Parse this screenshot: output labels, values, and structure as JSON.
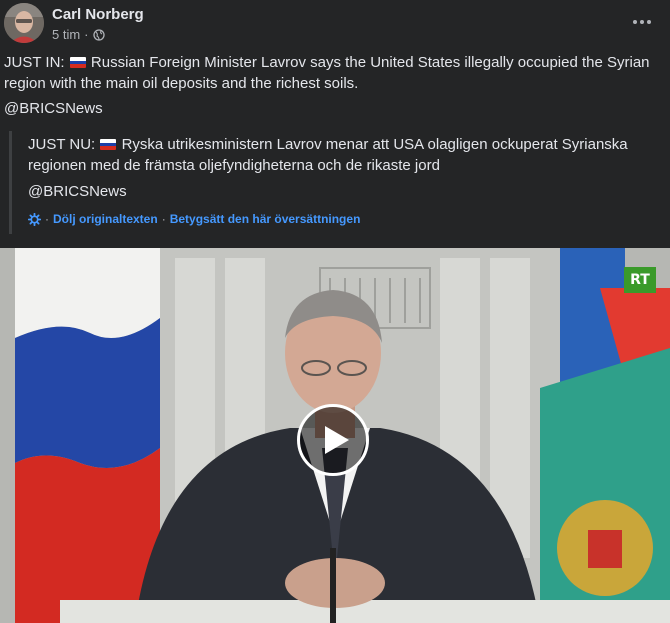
{
  "post": {
    "author": "Carl Norberg",
    "time": "5 tim",
    "separator": "·",
    "text_prefix": "JUST IN:",
    "text_body": "Russian Foreign Minister Lavrov says the United States illegally occupied the Syrian region with the main oil deposits and the richest soils.",
    "handle": "@BRICSNews"
  },
  "translation": {
    "text_prefix": "JUST NU:",
    "text_body": "Ryska utrikesministern Lavrov menar att USA olagligen ockuperat Syrianska regionen med de främsta oljefyndigheterna och de rikaste jord",
    "handle": "@BRICSNews",
    "dot": "·",
    "hide_original": "Dölj originaltexten",
    "rate_translation": "Betygsätt den här översättningen"
  },
  "video": {
    "channel_logo": "RT"
  },
  "icons": {
    "globe": "globe-icon",
    "more": "more-options-icon",
    "settings": "gear-icon",
    "play": "play-icon",
    "flag": "russia-flag-icon"
  },
  "colors": {
    "background": "#242526",
    "text": "#e4e6eb",
    "secondary": "#b0b3b8",
    "link": "#4599ff",
    "rt_green": "#3a9a2a"
  }
}
